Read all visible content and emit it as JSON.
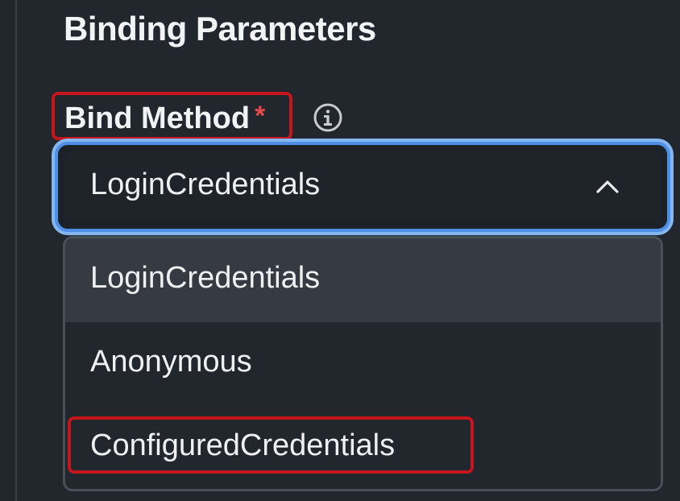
{
  "section": {
    "title": "Binding Parameters"
  },
  "field": {
    "label": "Bind Method",
    "required_marker": "*",
    "info_icon": "info-circle-icon",
    "selected_value": "LoginCredentials",
    "toggle_icon": "chevron-up-icon",
    "expanded": true
  },
  "dropdown": {
    "options": [
      {
        "label": "LoginCredentials",
        "active": true
      },
      {
        "label": "Anonymous",
        "active": false
      },
      {
        "label": "ConfiguredCredentials",
        "active": false
      }
    ]
  },
  "colors": {
    "background": "#22262d",
    "focus_ring": "#4d90e6",
    "required": "#e5484d",
    "annotation_box": "#c4161c",
    "option_active_bg": "#363a42"
  }
}
